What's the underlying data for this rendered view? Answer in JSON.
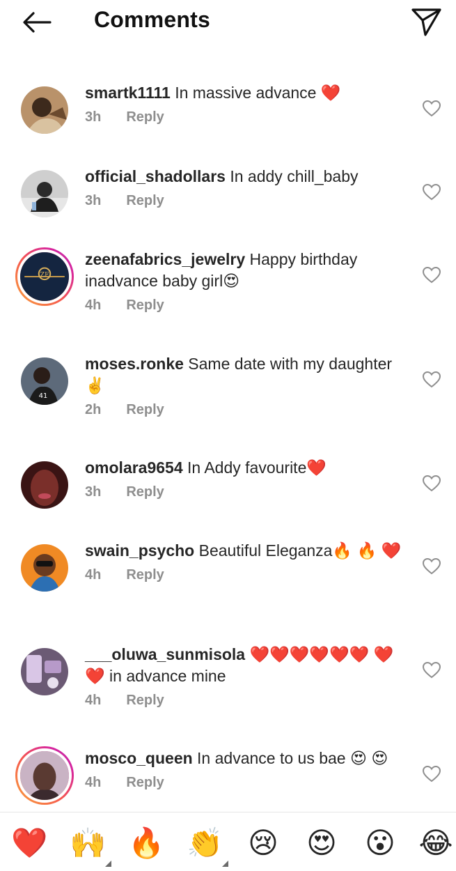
{
  "header": {
    "title": "Comments",
    "back_icon": "arrow-left-icon",
    "share_icon": "paper-plane-icon"
  },
  "colors": {
    "text": "#262626",
    "meta": "#8e8e8e",
    "story_ring_start": "#f9a33c",
    "story_ring_end": "#d6249f",
    "heart": "#e0262b"
  },
  "comments": [
    {
      "username": "smartk1111",
      "text": "In massive advance ❤️",
      "time": "3h",
      "reply": "Reply"
    },
    {
      "username": "official_shadollars",
      "text": "In addy chill_baby",
      "time": "3h",
      "reply": "Reply"
    },
    {
      "username": "zeenafabrics_jewelry",
      "text": "Happy birthday inadvance baby girl😍",
      "time": "4h",
      "reply": "Reply"
    },
    {
      "username": "moses.ronke",
      "text": "Same date with my daughter ✌️",
      "time": "2h",
      "reply": "Reply"
    },
    {
      "username": "omolara9654",
      "text": "In Addy favourite❤️",
      "time": "3h",
      "reply": "Reply"
    },
    {
      "username": "swain_psycho",
      "text": "Beautiful Eleganza🔥 🔥 ❤️",
      "time": "4h",
      "reply": "Reply"
    },
    {
      "username": "___oluwa_sunmisola",
      "text": "❤️❤️❤️❤️❤️❤️ ❤️❤️ in advance mine",
      "time": "4h",
      "reply": "Reply"
    },
    {
      "username": "mosco_queen",
      "text": "In advance to us bae 😍 😍",
      "time": "4h",
      "reply": "Reply"
    }
  ],
  "emoji_bar": [
    "❤️",
    "🙌",
    "🔥",
    "👏",
    "😢",
    "😍",
    "😮",
    "😂"
  ]
}
